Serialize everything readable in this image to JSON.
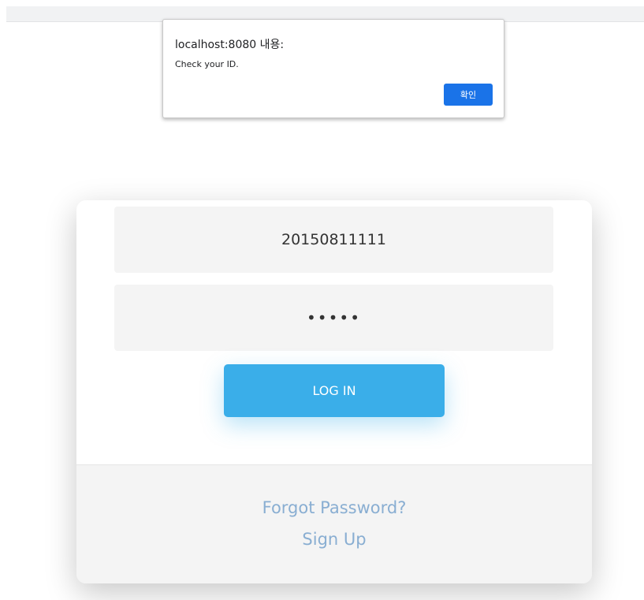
{
  "alert": {
    "title": "localhost:8080 내용:",
    "message": "Check your ID.",
    "ok_label": "확인"
  },
  "login_form": {
    "id_value": "20150811111",
    "password_value": "•••••",
    "login_label": "LOG IN"
  },
  "footer": {
    "forgot_password": "Forgot Password?",
    "sign_up": "Sign Up"
  },
  "colors": {
    "primary": "#3aaee9",
    "dialog_button": "#1a73e8",
    "link": "#89aed2",
    "field_background": "#f4f4f4"
  }
}
